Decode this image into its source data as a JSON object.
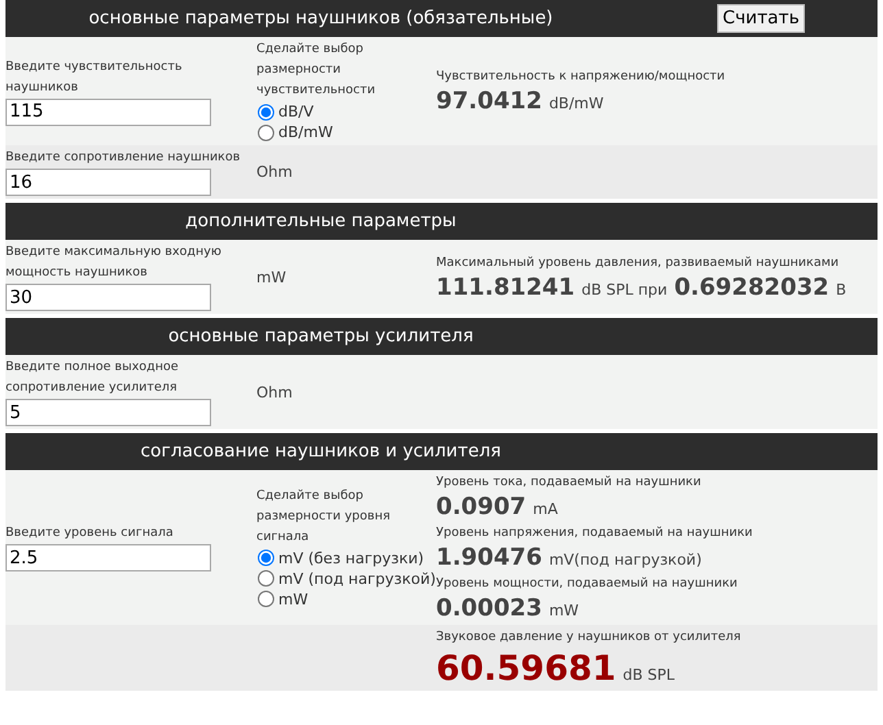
{
  "sections": [
    {
      "title": "основные параметры наушников (обязательные)",
      "button": "Считать",
      "rows": [
        {
          "input": {
            "label": "Введите чувствительность наушников",
            "value": "115"
          },
          "middle": {
            "kind": "radios",
            "label": "Сделайте выбор размерности чувствительности",
            "options": [
              {
                "label": "dB/V",
                "selected": true
              },
              {
                "label": "dB/mW",
                "selected": false
              }
            ]
          },
          "results": [
            {
              "label": "Чувствительность к напряжению/мощности",
              "parts": [
                {
                  "kind": "number",
                  "text": "97.0412"
                },
                {
                  "kind": "unit",
                  "text": "dB/mW"
                }
              ]
            }
          ]
        },
        {
          "input": {
            "label": "Введите сопротивление наушников",
            "value": "16"
          },
          "middle": {
            "kind": "unit",
            "text": "Ohm"
          },
          "results": []
        }
      ]
    },
    {
      "title": "дополнительные параметры",
      "rows": [
        {
          "input": {
            "label": "Введите максимальную входную мощность наушников",
            "value": "30"
          },
          "middle": {
            "kind": "unit",
            "text": "mW"
          },
          "results": [
            {
              "label": "Максимальный уровень давления, развиваемый наушниками",
              "parts": [
                {
                  "kind": "number",
                  "text": "111.81241"
                },
                {
                  "kind": "unit",
                  "text": "dB SPL при"
                },
                {
                  "kind": "number",
                  "text": "0.69282032"
                },
                {
                  "kind": "unit",
                  "text": "В"
                }
              ]
            }
          ]
        }
      ]
    },
    {
      "title": "основные параметры усилителя",
      "rows": [
        {
          "input": {
            "label": "Введите полное выходное сопротивление усилителя",
            "value": "5"
          },
          "middle": {
            "kind": "unit",
            "text": "Ohm"
          },
          "results": []
        }
      ]
    },
    {
      "title": "согласование наушников и усилителя",
      "rows": [
        {
          "input": {
            "label": "Введите уровень сигнала",
            "value": "2.5"
          },
          "middle": {
            "kind": "radios",
            "label": "Сделайте выбор размерности уровня сигнала",
            "options": [
              {
                "label": "mV (без нагрузки)",
                "selected": true
              },
              {
                "label": "mV (под нагрузкой)",
                "selected": false
              },
              {
                "label": "mW",
                "selected": false
              }
            ]
          },
          "results": [
            {
              "label": "Уровень тока, подаваемый на наушники",
              "parts": [
                {
                  "kind": "number",
                  "text": "0.0907"
                },
                {
                  "kind": "unit",
                  "text": "mA"
                }
              ]
            },
            {
              "label": "Уровень напряжения, подаваемый на наушники",
              "parts": [
                {
                  "kind": "number",
                  "text": "1.90476"
                },
                {
                  "kind": "unit",
                  "text": "mV(под нагрузкой)"
                }
              ]
            },
            {
              "label": "Уровень мощности, подаваемый на наушники",
              "parts": [
                {
                  "kind": "number",
                  "text": "0.00023"
                },
                {
                  "kind": "unit",
                  "text": "mW"
                }
              ]
            }
          ]
        },
        {
          "results": [
            {
              "label": "Звуковое давление у наушников от усилителя",
              "parts": [
                {
                  "kind": "highlight",
                  "text": "60.59681"
                },
                {
                  "kind": "unit",
                  "text": "dB SPL"
                }
              ]
            }
          ]
        }
      ]
    }
  ]
}
